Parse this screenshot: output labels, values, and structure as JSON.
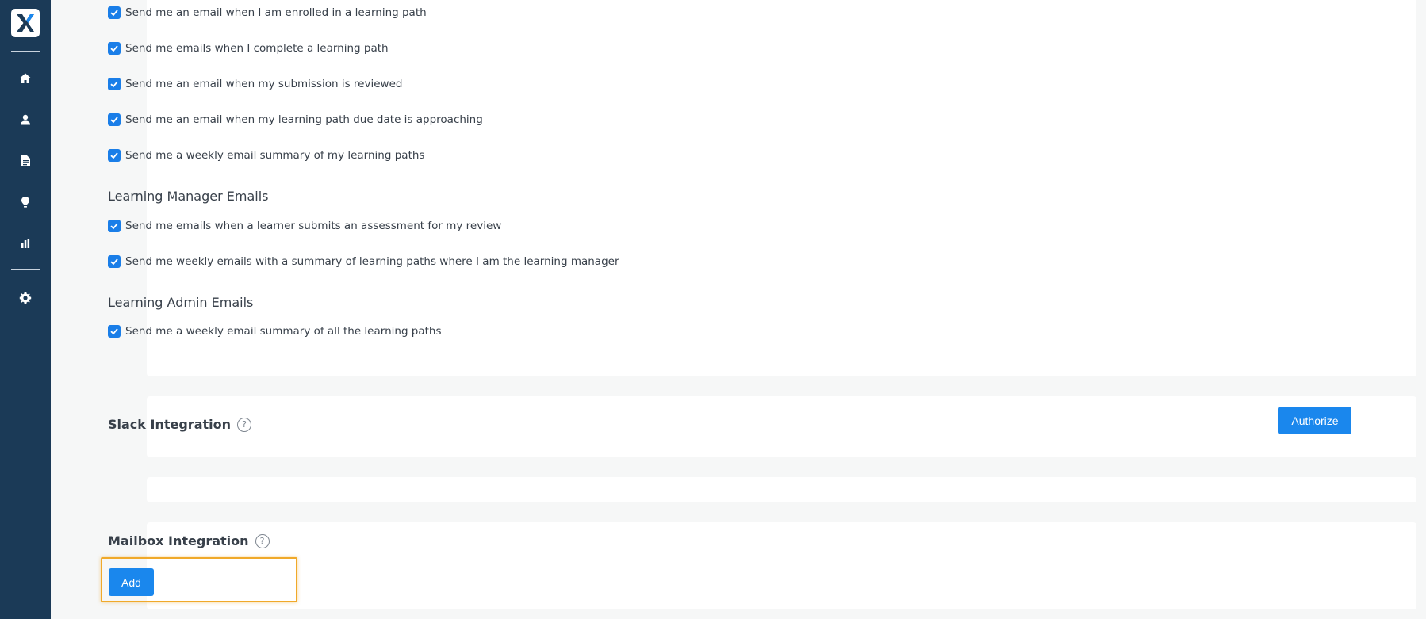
{
  "sidebar": {
    "logo": "X",
    "icons": [
      "home-icon",
      "user-icon",
      "document-icon",
      "lightbulb-icon",
      "bar-chart-icon",
      "gear-icon"
    ]
  },
  "learner_emails": [
    "Send me an email when I am enrolled in a learning path",
    "Send me emails when I complete a learning path",
    "Send me an email when my submission is reviewed",
    "Send me an email when my learning path due date is approaching",
    "Send me a weekly email summary of my learning paths"
  ],
  "manager_section": {
    "title": "Learning Manager Emails",
    "items": [
      "Send me emails when a learner submits an assessment for my review",
      "Send me weekly emails with a summary of learning paths where I am the learning manager"
    ]
  },
  "admin_section": {
    "title": "Learning Admin Emails",
    "items": [
      "Send me a weekly email summary of all the learning paths"
    ]
  },
  "slack": {
    "title": "Slack Integration",
    "button": "Authorize"
  },
  "mailbox": {
    "title": "Mailbox Integration",
    "button": "Add"
  },
  "help_glyph": "?",
  "colors": {
    "sidebar": "#1b3a57",
    "accent": "#1a87ed",
    "highlight": "#f0a92a"
  }
}
